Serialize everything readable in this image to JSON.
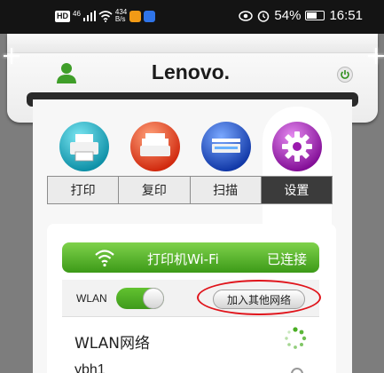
{
  "status_bar": {
    "hd_badge": "HD",
    "signal_text": "46",
    "net_speed_value": "434",
    "net_speed_unit": "B/s",
    "battery": "54%",
    "time": "16:51",
    "icons": [
      "signal-icon",
      "wifi-icon",
      "app-notification-icon",
      "gallery-app-icon",
      "eye-icon",
      "alarm-icon",
      "battery-icon"
    ]
  },
  "header": {
    "brand": "Lenovo.",
    "icons": [
      "user-icon",
      "power-icon"
    ]
  },
  "functions": {
    "icons": [
      "print-icon",
      "copy-icon",
      "scan-icon",
      "settings-gear-icon"
    ],
    "colors": {
      "print": "#19b3c8",
      "copy": "#ea3d16",
      "scan": "#1a52c9",
      "settings": "#a01ab4"
    }
  },
  "tabs": [
    {
      "label": "打印"
    },
    {
      "label": "复印"
    },
    {
      "label": "扫描"
    },
    {
      "label": "设置",
      "active": true
    }
  ],
  "wifi_panel": {
    "network_name": "打印机Wi-Fi",
    "status": "已连接",
    "accent": "#4caf1f"
  },
  "wlan": {
    "label": "WLAN",
    "enabled": true,
    "join_button": "加入其他网络"
  },
  "network_list": {
    "title": "WLAN网络",
    "items": [
      {
        "name": "ybh1"
      }
    ]
  }
}
